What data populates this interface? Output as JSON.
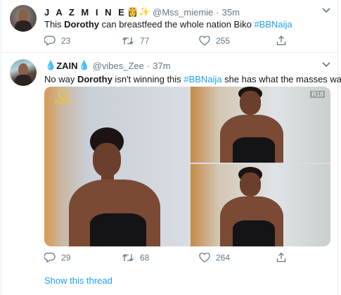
{
  "tweets": [
    {
      "name": "J A Z M I N E",
      "name_emoji": "👸✨",
      "handle": "@Mss_miemie",
      "time": "35m",
      "text_before": "This ",
      "text_bold": "Dorothy",
      "text_after": " can breastfeed the whole nation Biko ",
      "hashtag": "#BBNaija",
      "replies": "23",
      "retweets": "77",
      "likes": "255"
    },
    {
      "name_prefix_emoji": "💧",
      "name": "ZAIN",
      "name_emoji": "💧",
      "handle": "@vibes_Zee",
      "time": "37m",
      "text_before": "No way ",
      "text_bold": "Dorothy",
      "text_middle": " isn't winning this ",
      "hashtag": "#BBNaija",
      "text_after": " she has what the masses want.",
      "replies": "29",
      "retweets": "68",
      "likes": "264",
      "media": {
        "logo_text": "NAIJA",
        "rating": "R18"
      },
      "show_thread": "Show this thread"
    }
  ],
  "colors": {
    "link": "#1da1f2",
    "muted": "#657786",
    "text": "#14171a",
    "border": "#e6ecf0"
  },
  "icons": [
    "reply-icon",
    "retweet-icon",
    "like-icon",
    "share-icon",
    "chevron-down-icon"
  ]
}
